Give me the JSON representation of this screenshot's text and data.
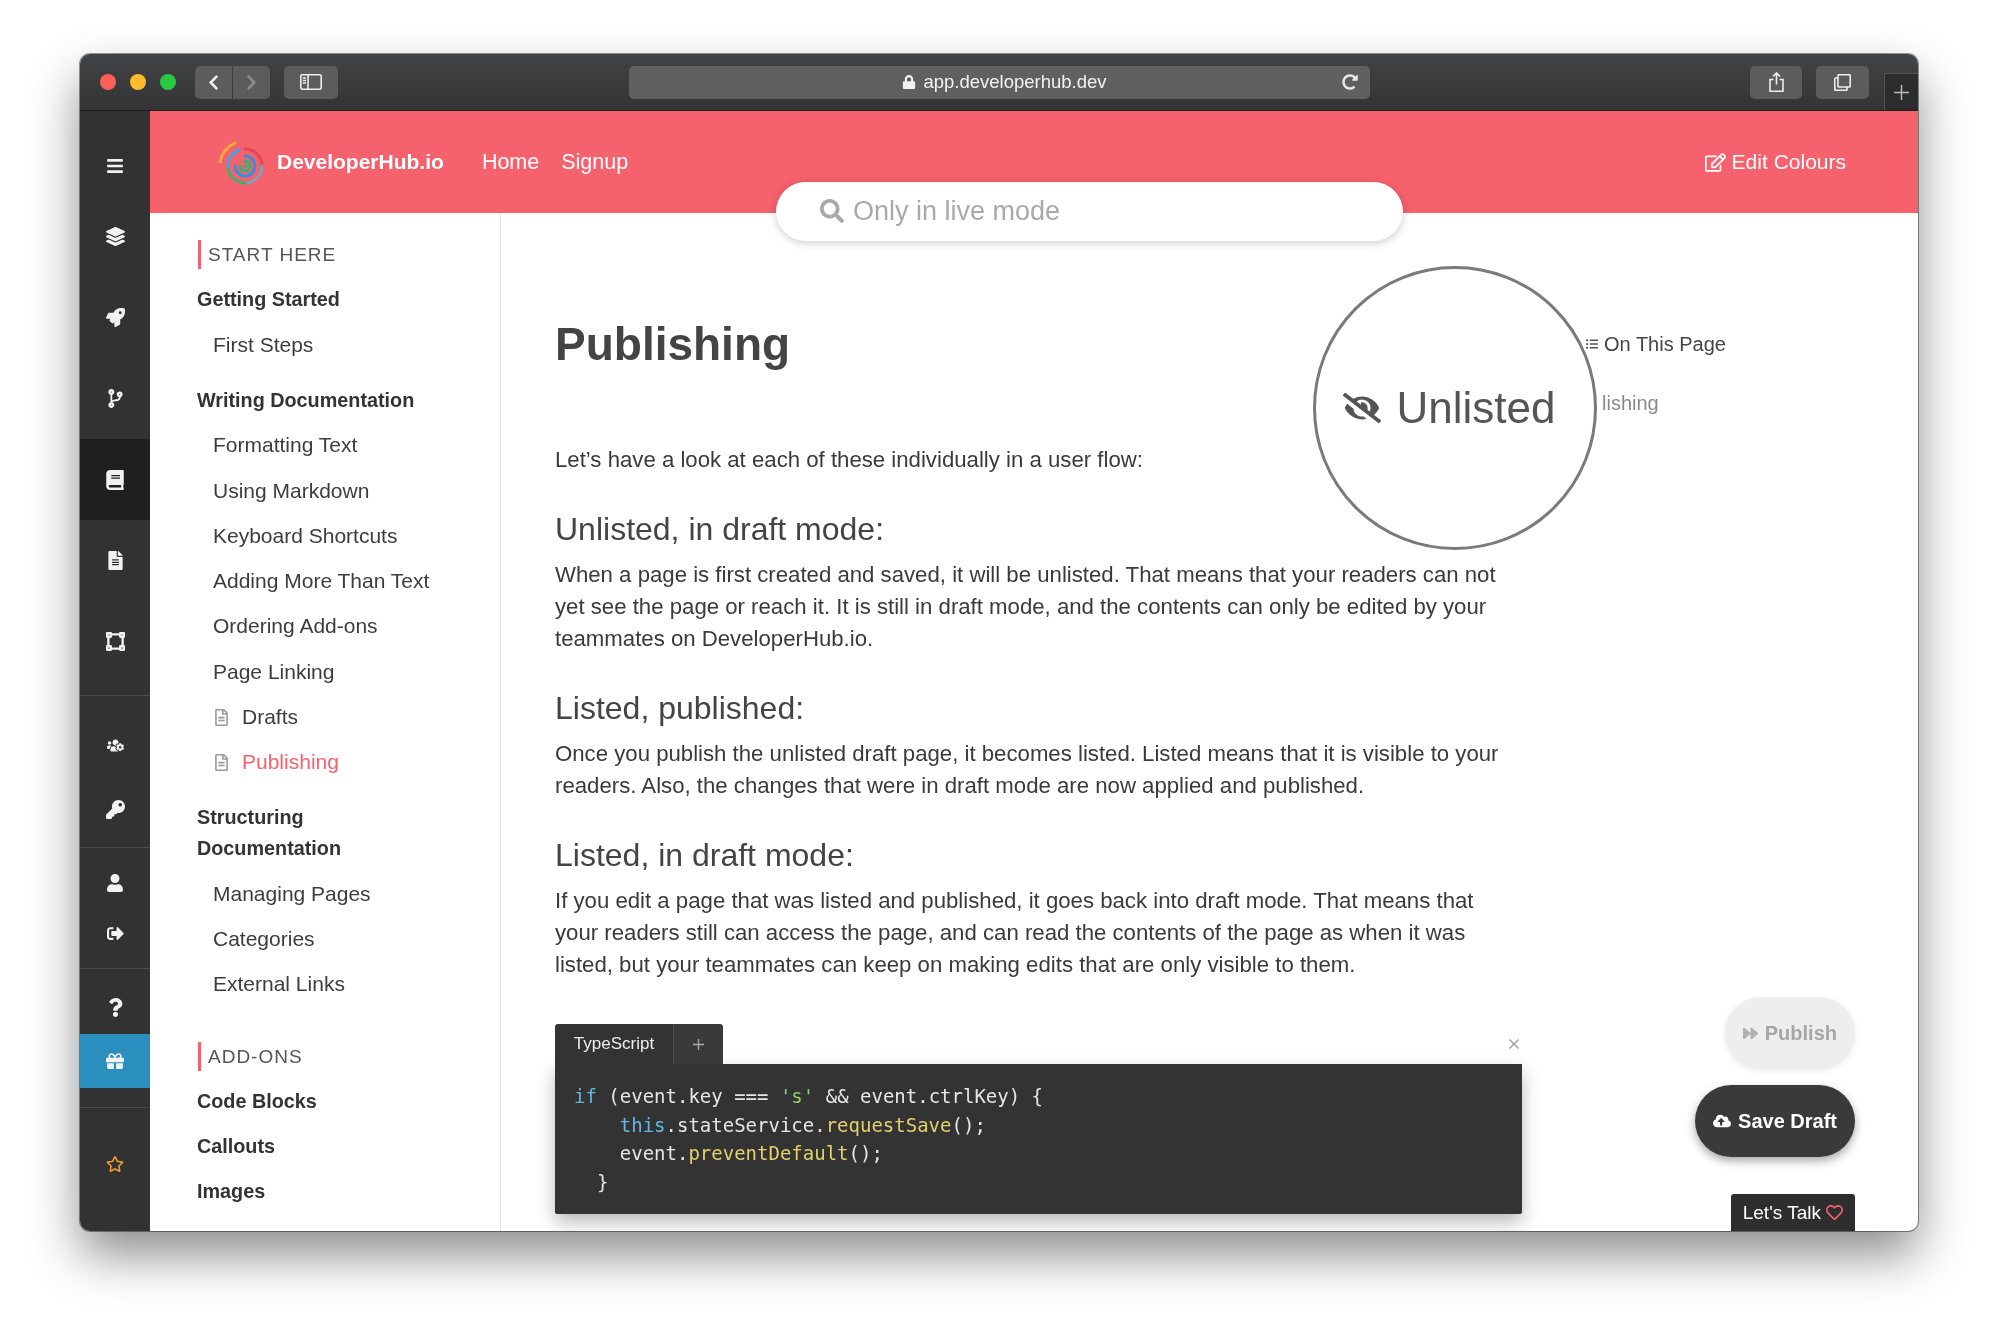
{
  "browser": {
    "url": "app.developerhub.dev",
    "back": {
      "disabled": false
    },
    "forward": {
      "disabled": true
    }
  },
  "rail": {
    "groups": [
      {
        "items": [
          {
            "selected": false,
            "highlighted": false
          },
          {
            "selected": false,
            "highlighted": false
          },
          {
            "selected": false,
            "highlighted": false
          },
          {
            "selected": false,
            "highlighted": false
          },
          {
            "selected": true,
            "highlighted": false
          },
          {
            "selected": false,
            "highlighted": false
          },
          {
            "selected": false,
            "highlighted": false
          }
        ]
      },
      {
        "items": [
          {
            "selected": false,
            "highlighted": false
          },
          {
            "selected": false,
            "highlighted": false
          }
        ]
      },
      {
        "items": [
          {
            "selected": false,
            "highlighted": false
          },
          {
            "selected": false,
            "highlighted": false
          }
        ]
      },
      {
        "items": [
          {
            "selected": false,
            "highlighted": false
          },
          {
            "selected": false,
            "highlighted": true
          }
        ]
      },
      {
        "items": [
          {
            "selected": false,
            "highlighted": false
          }
        ]
      }
    ]
  },
  "header": {
    "brand": "DeveloperHub.io",
    "nav": [
      {
        "label": "Home"
      },
      {
        "label": "Signup"
      }
    ],
    "edit_button": "Edit Colours"
  },
  "search": {
    "placeholder": "Only in live mode"
  },
  "sidebar": {
    "sections": [
      {
        "heading": "START HERE",
        "groups": [
          {
            "title": "Getting Started",
            "selected": false,
            "children": [
              {
                "label": "First Steps",
                "kind": "topic",
                "selected": false
              }
            ]
          },
          {
            "title": "Writing Documentation",
            "selected": false,
            "children": [
              {
                "label": "Formatting Text",
                "kind": "topic",
                "selected": false
              },
              {
                "label": "Using Markdown",
                "kind": "topic",
                "selected": false
              },
              {
                "label": "Keyboard Shortcuts",
                "kind": "topic",
                "selected": false
              },
              {
                "label": "Adding More Than Text",
                "kind": "topic",
                "selected": false
              },
              {
                "label": "Ordering Add-ons",
                "kind": "topic",
                "selected": false
              },
              {
                "label": "Page Linking",
                "kind": "topic",
                "selected": false
              },
              {
                "label": "Drafts",
                "kind": "page",
                "selected": false
              },
              {
                "label": "Publishing",
                "kind": "page",
                "selected": true
              }
            ]
          },
          {
            "title": "Structuring Documentation",
            "selected": false,
            "children": [
              {
                "label": "Managing Pages",
                "kind": "topic",
                "selected": false
              },
              {
                "label": "Categories",
                "kind": "topic",
                "selected": false
              },
              {
                "label": "External Links",
                "kind": "topic",
                "selected": false
              }
            ]
          }
        ]
      },
      {
        "heading": "ADD-ONS",
        "groups": [
          {
            "title": "Code Blocks",
            "selected": false
          },
          {
            "title": "Callouts",
            "selected": false
          },
          {
            "title": "Images",
            "selected": false
          }
        ]
      }
    ]
  },
  "article": {
    "title": "Publishing",
    "intro": "Let’s have a look at each of these individually in a user flow:",
    "sections": [
      {
        "heading": "Unlisted, in draft mode:",
        "body": "When a page is first created and saved, it will be unlisted. That means that your readers can not yet see the page or reach it. It is still in draft mode, and the contents can only be edited by your teammates on DeveloperHub.io."
      },
      {
        "heading": "Listed, published:",
        "body": "Once you publish the unlisted draft page, it becomes listed. Listed means that it is visible to your readers. Also, the changes that were in draft mode are now applied and published."
      },
      {
        "heading": "Listed, in draft mode:",
        "body": "If you edit a page that was listed and published, it goes back into draft mode. That means that your readers still can access the page, and can read the contents of the page as when it was listed, but your teammates can keep on making edits that are only visible to them."
      }
    ],
    "code_block": {
      "tabs": [
        {
          "label": "TypeScript",
          "selected": true
        }
      ],
      "lines": [
        {
          "tokens": [
            {
              "kind": "keyword",
              "text": "if"
            },
            {
              "kind": "plain",
              "text": " (event.key === "
            },
            {
              "kind": "string",
              "text": "'s'"
            },
            {
              "kind": "plain",
              "text": " && event.ctrlKey) {"
            }
          ]
        },
        {
          "tokens": [
            {
              "kind": "keyword",
              "text": "    this"
            },
            {
              "kind": "plain",
              "text": ".stateService."
            },
            {
              "kind": "function",
              "text": "requestSave"
            },
            {
              "kind": "plain",
              "text": "();"
            }
          ]
        },
        {
          "tokens": [
            {
              "kind": "plain",
              "text": "    event."
            },
            {
              "kind": "function",
              "text": "preventDefault"
            },
            {
              "kind": "plain",
              "text": "();"
            }
          ]
        },
        {
          "tokens": [
            {
              "kind": "plain",
              "text": "  }"
            }
          ]
        }
      ]
    }
  },
  "toc": {
    "heading": "On This Page",
    "items": [
      {
        "label": "lishing",
        "selected": false
      }
    ]
  },
  "magnifier": {
    "label": "Unlisted"
  },
  "actions": [
    {
      "kind": "publish",
      "label": "Publish",
      "disabled": true
    },
    {
      "kind": "save",
      "label": "Save Draft",
      "disabled": false
    }
  ],
  "chat": {
    "label": "Let's Talk"
  }
}
